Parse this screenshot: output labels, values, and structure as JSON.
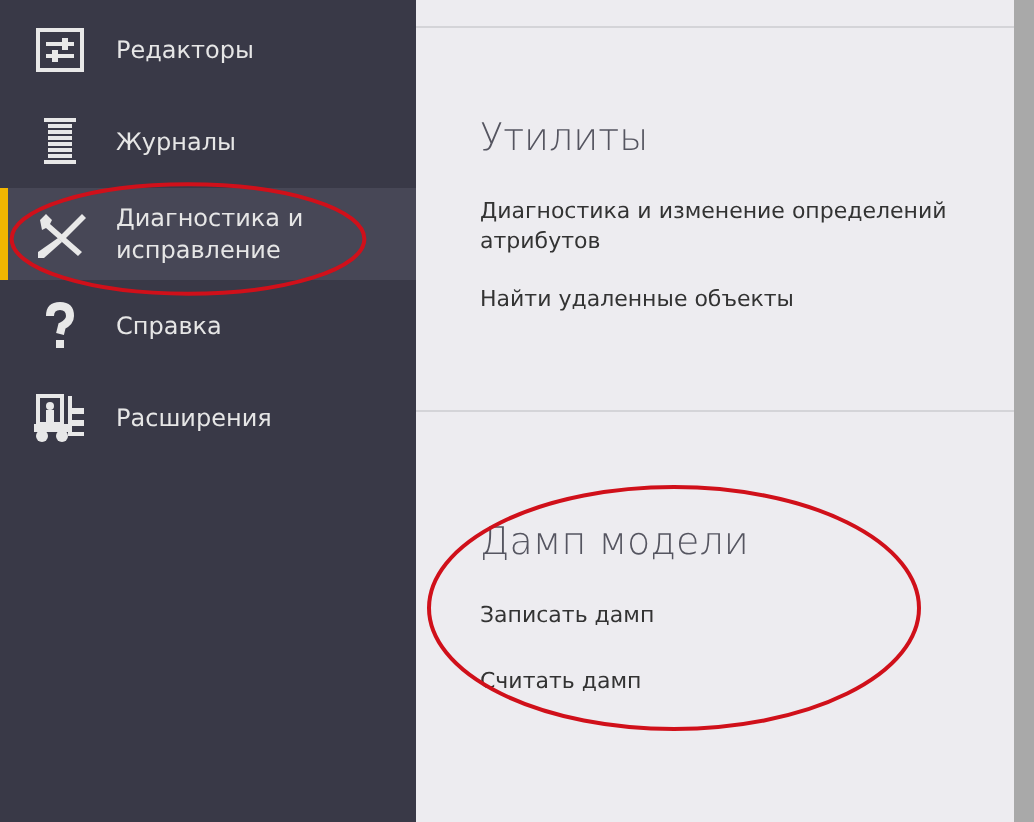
{
  "sidebar": {
    "items": [
      {
        "label": "Редакторы",
        "selected": false
      },
      {
        "label": "Журналы",
        "selected": false
      },
      {
        "label": "Диагностика и исправление",
        "selected": true
      },
      {
        "label": "Справка",
        "selected": false
      },
      {
        "label": "Расширения",
        "selected": false
      }
    ]
  },
  "sections": [
    {
      "title": "Утилиты",
      "links": [
        "Диагностика и изменение определений атрибутов",
        "Найти удаленные объекты"
      ]
    },
    {
      "title": "Дамп модели",
      "links": [
        "Записать дамп",
        "Считать дамп"
      ]
    }
  ],
  "annotations": [
    {
      "kind": "ellipse"
    },
    {
      "kind": "ellipse"
    }
  ]
}
